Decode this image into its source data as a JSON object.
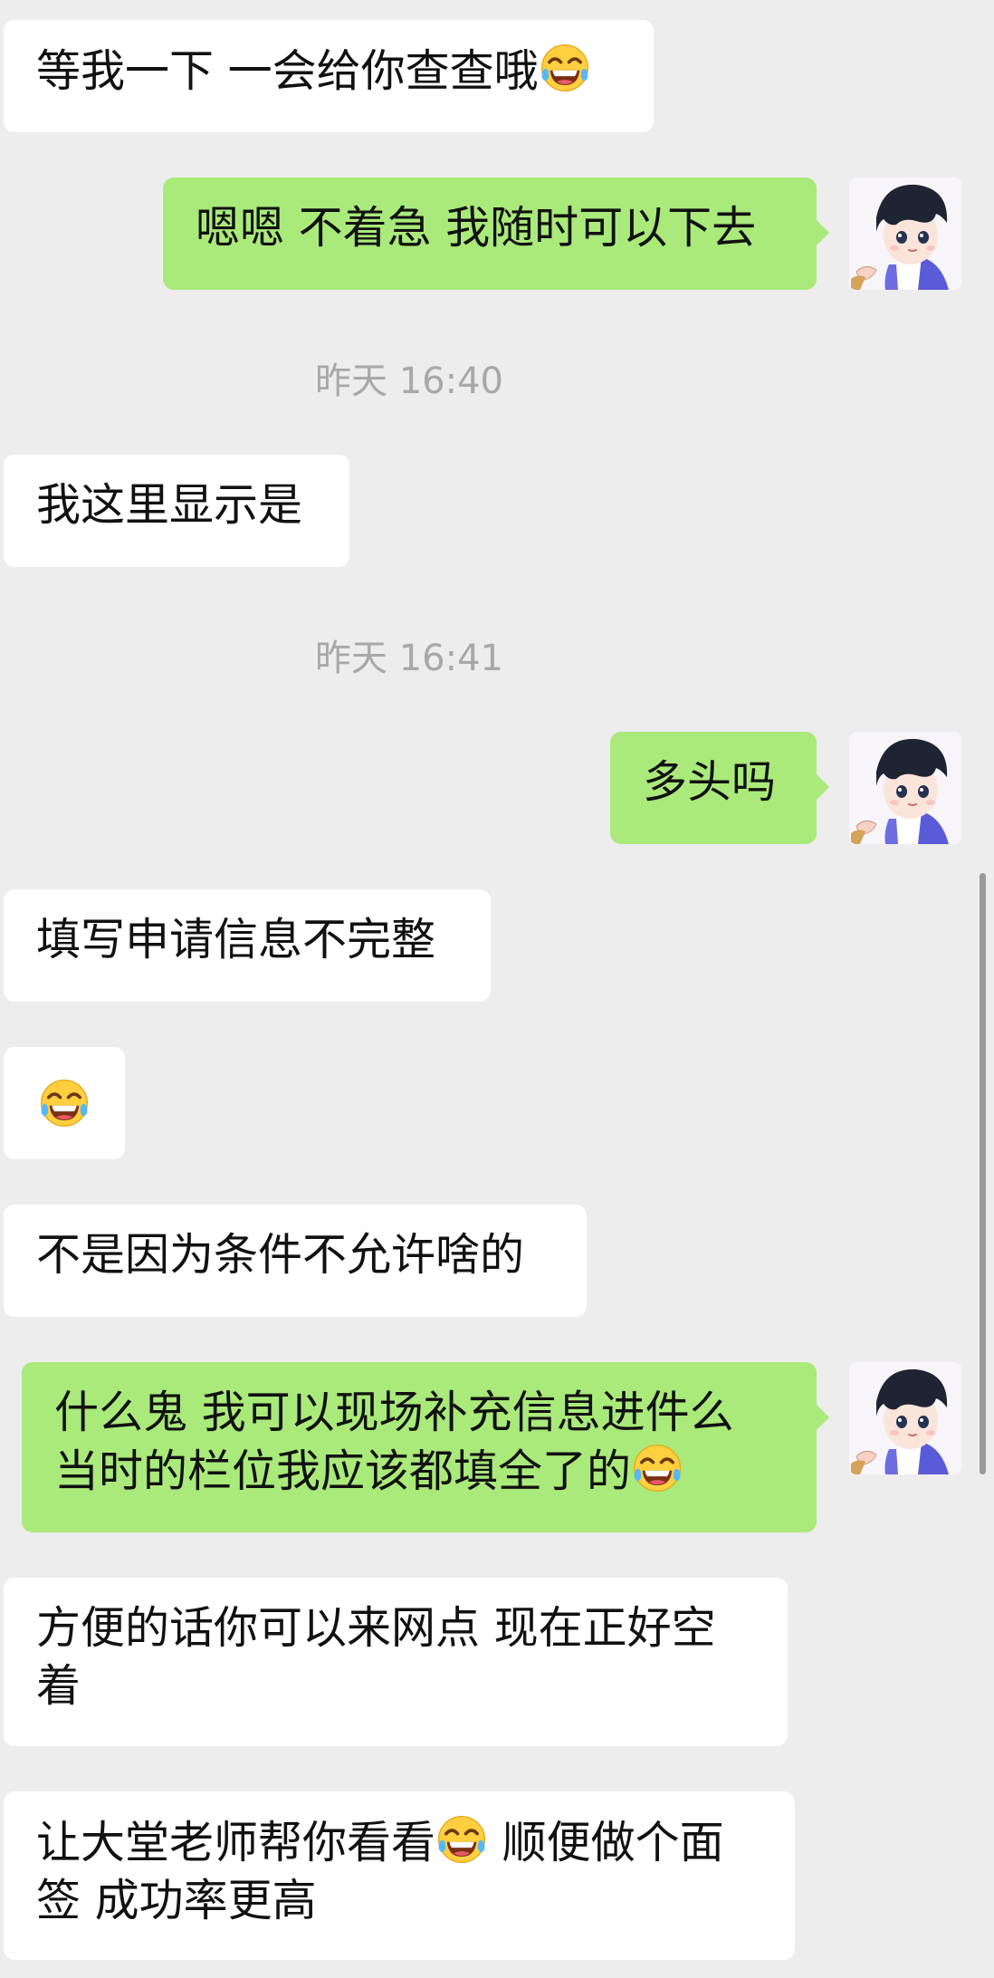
{
  "timestamps": {
    "t1": "昨天 16:40",
    "t2": "昨天 16:41"
  },
  "messages": {
    "m1": "等我一下 一会给你查查哦",
    "m2": "嗯嗯 不着急 我随时可以下去",
    "m3": "我这里显示是",
    "m4": "多头吗",
    "m5": "填写申请信息不完整",
    "m7": "不是因为条件不允许啥的",
    "m8_line1": "什么鬼 我可以现场补充信息进件么",
    "m8_line2": "当时的栏位我应该都填全了的",
    "m9": "方便的话你可以来网点 现在正好空着",
    "m10_part1": "让大堂老师帮你看看",
    "m10_part2": " 顺便做个面签 成功率更高"
  },
  "icons": {
    "emoji": "tears-of-joy-emoji",
    "avatar": "cartoon-boy-avatar"
  },
  "colors": {
    "background": "#ededed",
    "incoming_bubble": "#ffffff",
    "outgoing_bubble": "#a9ea7a",
    "timestamp_text": "#a8a8a8"
  }
}
